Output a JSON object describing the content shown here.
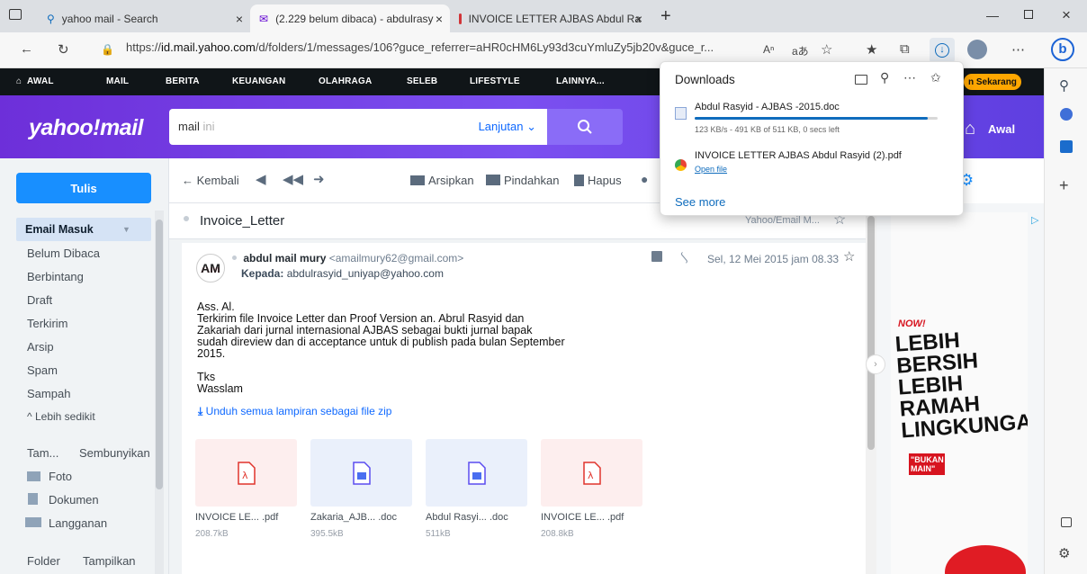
{
  "browser": {
    "tabs": [
      {
        "label": "yahoo mail - Search"
      },
      {
        "label": "(2.229 belum dibaca) - abdulrasy"
      },
      {
        "label": "INVOICE LETTER AJBAS Abdul Ra"
      }
    ],
    "url_prefix": "https://",
    "url_host": "id.mail.yahoo.com",
    "url_rest": "/d/folders/1/messages/106?guce_referrer=aHR0cHM6Ly93d3cuYmluZy5jb20v&guce_r..."
  },
  "downloads": {
    "title": "Downloads",
    "items": [
      {
        "name": "Abdul Rasyid - AJBAS -2015.doc",
        "status": "123 KB/s - 491 KB of 511 KB, 0 secs left",
        "progress": 0.96
      },
      {
        "name": "INVOICE LETTER AJBAS Abdul Rasyid (2).pdf",
        "action": "Open file"
      }
    ],
    "see_more": "See more"
  },
  "yahoo_nav": {
    "items": [
      "AWAL",
      "MAIL",
      "BERITA",
      "KEUANGAN",
      "OLAHRAGA",
      "SELEB",
      "LIFESTYLE",
      "LAINNYA..."
    ],
    "promo": "n Sekarang"
  },
  "header": {
    "logo": "yahoo!mail",
    "search_value": "mail",
    "search_placeholder": " ini",
    "advanced": "Lanjutan",
    "home": "Awal"
  },
  "sidebar": {
    "compose": "Tulis",
    "inbox": "Email Masuk",
    "folders": [
      "Belum Dibaca",
      "Berbintang",
      "Draft",
      "Terkirim",
      "Arsip",
      "Spam",
      "Sampah"
    ],
    "less": "^ Lebih sedikit",
    "views_label": "Tam...",
    "hide": "Sembunyikan",
    "views": [
      "Foto",
      "Dokumen",
      "Langganan"
    ],
    "folder_label": "Folder",
    "show": "Tampilkan"
  },
  "toolbar": {
    "back": "Kembali",
    "archive": "Arsipkan",
    "move": "Pindahkan",
    "delete": "Hapus"
  },
  "message": {
    "subject": "Invoice_Letter",
    "folder_tag": "Yahoo/Email M...",
    "sender_name": "abdul mail mury",
    "sender_email": "<amailmury62@gmail.com>",
    "to_label": "Kepada:",
    "to_email": "abdulrasyid_uniyap@yahoo.com",
    "date": "Sel, 12 Mei 2015 jam 08.33",
    "avatar": "AM",
    "body": [
      "Ass. Al.",
      "Terkirim file Invoice Letter dan Proof Version an. Abrul Rasyid dan",
      "Zakariah dari jurnal internasional AJBAS sebagai bukti jurnal bapak",
      "sudah direview dan di acceptance untuk di publish pada bulan September",
      "2015.",
      "",
      "Tks",
      "Wasslam"
    ],
    "download_all": "Unduh semua lampiran sebagai file zip",
    "attachments": [
      {
        "name": "INVOICE LE...",
        "ext": ".pdf",
        "size": "208.7kB",
        "type": "pdf"
      },
      {
        "name": "Zakaria_AJB...",
        "ext": ".doc",
        "size": "395.5kB",
        "type": "doc"
      },
      {
        "name": "Abdul Rasyi...",
        "ext": ".doc",
        "size": "511kB",
        "type": "doc"
      },
      {
        "name": "INVOICE LE...",
        "ext": ".pdf",
        "size": "208.8kB",
        "type": "pdf"
      }
    ]
  },
  "ad": {
    "badge": "NOW!",
    "lines": [
      "LEBIH",
      "BERSIH",
      "LEBIH",
      "RAMAH",
      "LINGKUNGAN"
    ],
    "tag": "\"BUKAN MAIN\""
  },
  "colors": {
    "yahoo_purple": "#6001d2",
    "compose_blue": "#188fff",
    "link_blue": "#0f69ff"
  }
}
